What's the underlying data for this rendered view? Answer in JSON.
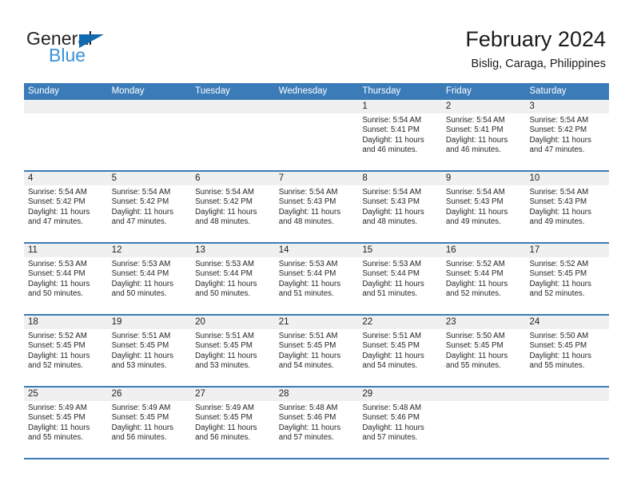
{
  "brand": {
    "name_dark": "General",
    "name_blue": "Blue",
    "accent_blue": "#3b7cb8",
    "logo_triangle_color": "#1169b0",
    "logo_blue_text_color": "#3a91d6"
  },
  "header": {
    "title": "February 2024",
    "subtitle": "Bislig, Caraga, Philippines"
  },
  "weekdays": [
    "Sunday",
    "Monday",
    "Tuesday",
    "Wednesday",
    "Thursday",
    "Friday",
    "Saturday"
  ],
  "weeks": [
    [
      {
        "day": "",
        "sunrise": "",
        "sunset": "",
        "daylight1": "",
        "daylight2": ""
      },
      {
        "day": "",
        "sunrise": "",
        "sunset": "",
        "daylight1": "",
        "daylight2": ""
      },
      {
        "day": "",
        "sunrise": "",
        "sunset": "",
        "daylight1": "",
        "daylight2": ""
      },
      {
        "day": "",
        "sunrise": "",
        "sunset": "",
        "daylight1": "",
        "daylight2": ""
      },
      {
        "day": "1",
        "sunrise": "Sunrise: 5:54 AM",
        "sunset": "Sunset: 5:41 PM",
        "daylight1": "Daylight: 11 hours",
        "daylight2": "and 46 minutes."
      },
      {
        "day": "2",
        "sunrise": "Sunrise: 5:54 AM",
        "sunset": "Sunset: 5:41 PM",
        "daylight1": "Daylight: 11 hours",
        "daylight2": "and 46 minutes."
      },
      {
        "day": "3",
        "sunrise": "Sunrise: 5:54 AM",
        "sunset": "Sunset: 5:42 PM",
        "daylight1": "Daylight: 11 hours",
        "daylight2": "and 47 minutes."
      }
    ],
    [
      {
        "day": "4",
        "sunrise": "Sunrise: 5:54 AM",
        "sunset": "Sunset: 5:42 PM",
        "daylight1": "Daylight: 11 hours",
        "daylight2": "and 47 minutes."
      },
      {
        "day": "5",
        "sunrise": "Sunrise: 5:54 AM",
        "sunset": "Sunset: 5:42 PM",
        "daylight1": "Daylight: 11 hours",
        "daylight2": "and 47 minutes."
      },
      {
        "day": "6",
        "sunrise": "Sunrise: 5:54 AM",
        "sunset": "Sunset: 5:42 PM",
        "daylight1": "Daylight: 11 hours",
        "daylight2": "and 48 minutes."
      },
      {
        "day": "7",
        "sunrise": "Sunrise: 5:54 AM",
        "sunset": "Sunset: 5:43 PM",
        "daylight1": "Daylight: 11 hours",
        "daylight2": "and 48 minutes."
      },
      {
        "day": "8",
        "sunrise": "Sunrise: 5:54 AM",
        "sunset": "Sunset: 5:43 PM",
        "daylight1": "Daylight: 11 hours",
        "daylight2": "and 48 minutes."
      },
      {
        "day": "9",
        "sunrise": "Sunrise: 5:54 AM",
        "sunset": "Sunset: 5:43 PM",
        "daylight1": "Daylight: 11 hours",
        "daylight2": "and 49 minutes."
      },
      {
        "day": "10",
        "sunrise": "Sunrise: 5:54 AM",
        "sunset": "Sunset: 5:43 PM",
        "daylight1": "Daylight: 11 hours",
        "daylight2": "and 49 minutes."
      }
    ],
    [
      {
        "day": "11",
        "sunrise": "Sunrise: 5:53 AM",
        "sunset": "Sunset: 5:44 PM",
        "daylight1": "Daylight: 11 hours",
        "daylight2": "and 50 minutes."
      },
      {
        "day": "12",
        "sunrise": "Sunrise: 5:53 AM",
        "sunset": "Sunset: 5:44 PM",
        "daylight1": "Daylight: 11 hours",
        "daylight2": "and 50 minutes."
      },
      {
        "day": "13",
        "sunrise": "Sunrise: 5:53 AM",
        "sunset": "Sunset: 5:44 PM",
        "daylight1": "Daylight: 11 hours",
        "daylight2": "and 50 minutes."
      },
      {
        "day": "14",
        "sunrise": "Sunrise: 5:53 AM",
        "sunset": "Sunset: 5:44 PM",
        "daylight1": "Daylight: 11 hours",
        "daylight2": "and 51 minutes."
      },
      {
        "day": "15",
        "sunrise": "Sunrise: 5:53 AM",
        "sunset": "Sunset: 5:44 PM",
        "daylight1": "Daylight: 11 hours",
        "daylight2": "and 51 minutes."
      },
      {
        "day": "16",
        "sunrise": "Sunrise: 5:52 AM",
        "sunset": "Sunset: 5:44 PM",
        "daylight1": "Daylight: 11 hours",
        "daylight2": "and 52 minutes."
      },
      {
        "day": "17",
        "sunrise": "Sunrise: 5:52 AM",
        "sunset": "Sunset: 5:45 PM",
        "daylight1": "Daylight: 11 hours",
        "daylight2": "and 52 minutes."
      }
    ],
    [
      {
        "day": "18",
        "sunrise": "Sunrise: 5:52 AM",
        "sunset": "Sunset: 5:45 PM",
        "daylight1": "Daylight: 11 hours",
        "daylight2": "and 52 minutes."
      },
      {
        "day": "19",
        "sunrise": "Sunrise: 5:51 AM",
        "sunset": "Sunset: 5:45 PM",
        "daylight1": "Daylight: 11 hours",
        "daylight2": "and 53 minutes."
      },
      {
        "day": "20",
        "sunrise": "Sunrise: 5:51 AM",
        "sunset": "Sunset: 5:45 PM",
        "daylight1": "Daylight: 11 hours",
        "daylight2": "and 53 minutes."
      },
      {
        "day": "21",
        "sunrise": "Sunrise: 5:51 AM",
        "sunset": "Sunset: 5:45 PM",
        "daylight1": "Daylight: 11 hours",
        "daylight2": "and 54 minutes."
      },
      {
        "day": "22",
        "sunrise": "Sunrise: 5:51 AM",
        "sunset": "Sunset: 5:45 PM",
        "daylight1": "Daylight: 11 hours",
        "daylight2": "and 54 minutes."
      },
      {
        "day": "23",
        "sunrise": "Sunrise: 5:50 AM",
        "sunset": "Sunset: 5:45 PM",
        "daylight1": "Daylight: 11 hours",
        "daylight2": "and 55 minutes."
      },
      {
        "day": "24",
        "sunrise": "Sunrise: 5:50 AM",
        "sunset": "Sunset: 5:45 PM",
        "daylight1": "Daylight: 11 hours",
        "daylight2": "and 55 minutes."
      }
    ],
    [
      {
        "day": "25",
        "sunrise": "Sunrise: 5:49 AM",
        "sunset": "Sunset: 5:45 PM",
        "daylight1": "Daylight: 11 hours",
        "daylight2": "and 55 minutes."
      },
      {
        "day": "26",
        "sunrise": "Sunrise: 5:49 AM",
        "sunset": "Sunset: 5:45 PM",
        "daylight1": "Daylight: 11 hours",
        "daylight2": "and 56 minutes."
      },
      {
        "day": "27",
        "sunrise": "Sunrise: 5:49 AM",
        "sunset": "Sunset: 5:45 PM",
        "daylight1": "Daylight: 11 hours",
        "daylight2": "and 56 minutes."
      },
      {
        "day": "28",
        "sunrise": "Sunrise: 5:48 AM",
        "sunset": "Sunset: 5:46 PM",
        "daylight1": "Daylight: 11 hours",
        "daylight2": "and 57 minutes."
      },
      {
        "day": "29",
        "sunrise": "Sunrise: 5:48 AM",
        "sunset": "Sunset: 5:46 PM",
        "daylight1": "Daylight: 11 hours",
        "daylight2": "and 57 minutes."
      },
      {
        "day": "",
        "sunrise": "",
        "sunset": "",
        "daylight1": "",
        "daylight2": ""
      },
      {
        "day": "",
        "sunrise": "",
        "sunset": "",
        "daylight1": "",
        "daylight2": ""
      }
    ]
  ]
}
